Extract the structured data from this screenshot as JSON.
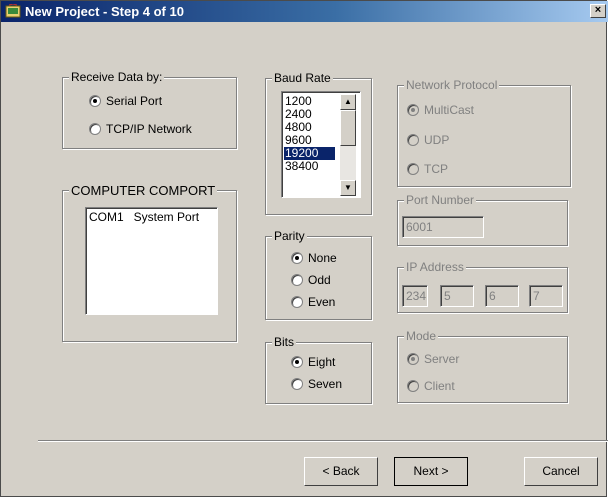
{
  "window": {
    "title": "New Project - Step 4 of 10",
    "close_label": "×"
  },
  "receive": {
    "legend": "Receive Data by:",
    "options": [
      "Serial Port",
      "TCP/IP Network"
    ],
    "selected": "Serial Port"
  },
  "comport": {
    "legend": "COMPUTER COMPORT",
    "items": [
      "COM1   System Port"
    ]
  },
  "baud": {
    "legend": "Baud Rate",
    "items": [
      "1200",
      "2400",
      "4800",
      "9600",
      "19200",
      "38400"
    ],
    "selected": "19200"
  },
  "parity": {
    "legend": "Parity",
    "options": [
      "None",
      "Odd",
      "Even"
    ],
    "selected": "None"
  },
  "bits": {
    "legend": "Bits",
    "options": [
      "Eight",
      "Seven"
    ],
    "selected": "Eight"
  },
  "network": {
    "legend": "Network Protocol",
    "options": [
      "MultiCast",
      "UDP",
      "TCP"
    ],
    "selected": "MultiCast",
    "enabled": false
  },
  "port": {
    "legend": "Port Number",
    "value": "6001"
  },
  "ip": {
    "legend": "IP Address",
    "octets": [
      "234",
      "5",
      "6",
      "7"
    ]
  },
  "mode": {
    "legend": "Mode",
    "options": [
      "Server",
      "Client"
    ],
    "selected": "Server"
  },
  "buttons": {
    "back": "< Back",
    "next": "Next >",
    "cancel": "Cancel"
  },
  "colors": {
    "face": "#d4d0c8",
    "titlebar_start": "#0a246a",
    "titlebar_end": "#a6caf0",
    "selection": "#0a246a"
  }
}
